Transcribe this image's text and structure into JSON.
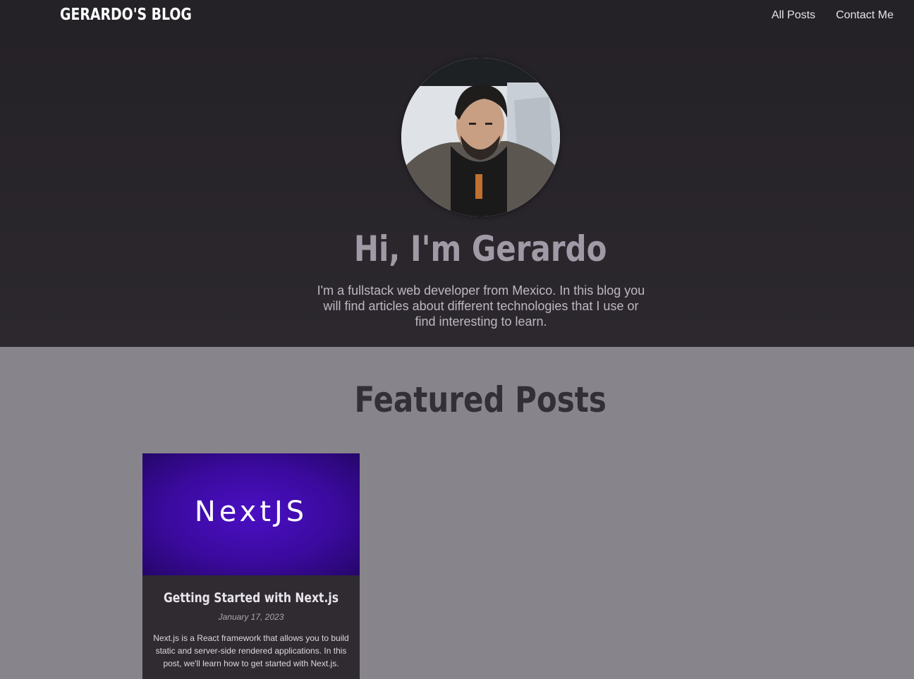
{
  "header": {
    "logo": "Gerardo's Blog",
    "nav": [
      {
        "label": "All Posts"
      },
      {
        "label": "Contact Me"
      }
    ]
  },
  "hero": {
    "title": "Hi, I'm Gerardo",
    "text": "I'm a fullstack web developer from Mexico. In this blog you will find articles about different technologies that I use or find interesting to learn."
  },
  "featured": {
    "title": "Featured Posts",
    "posts": [
      {
        "image_text": "NextJS",
        "title": "Getting Started with Next.js",
        "date": "January 17, 2023",
        "excerpt": "Next.js is a React framework that allows you to build static and server-side rendered applications. In this post, we'll learn how to get started with Next.js."
      }
    ]
  }
}
